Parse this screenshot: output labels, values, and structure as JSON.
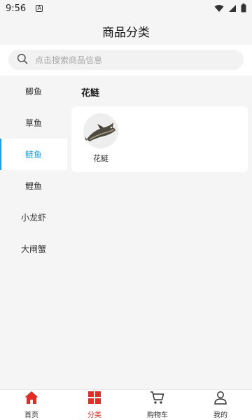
{
  "status_bar": {
    "time": "9:56",
    "indicator": "A"
  },
  "header": {
    "title": "商品分类"
  },
  "search": {
    "placeholder": "点击搜索商品信息"
  },
  "sidebar": {
    "items": [
      {
        "label": "鲫鱼",
        "active": false
      },
      {
        "label": "草鱼",
        "active": false
      },
      {
        "label": "鲢鱼",
        "active": true
      },
      {
        "label": "鲤鱼",
        "active": false
      },
      {
        "label": "小龙虾",
        "active": false
      },
      {
        "label": "大闸蟹",
        "active": false
      }
    ]
  },
  "content": {
    "section_title": "花鲢",
    "products": [
      {
        "name": "花鲢",
        "image": "fish-image"
      }
    ]
  },
  "tabbar": {
    "tabs": [
      {
        "label": "首页",
        "icon": "home-icon",
        "active": false
      },
      {
        "label": "分类",
        "icon": "category-icon",
        "active": true
      },
      {
        "label": "购物车",
        "icon": "cart-icon",
        "active": false
      },
      {
        "label": "我的",
        "icon": "user-icon",
        "active": false
      }
    ]
  },
  "colors": {
    "active_blue": "#1aa1ea",
    "active_red": "#e02e24"
  }
}
